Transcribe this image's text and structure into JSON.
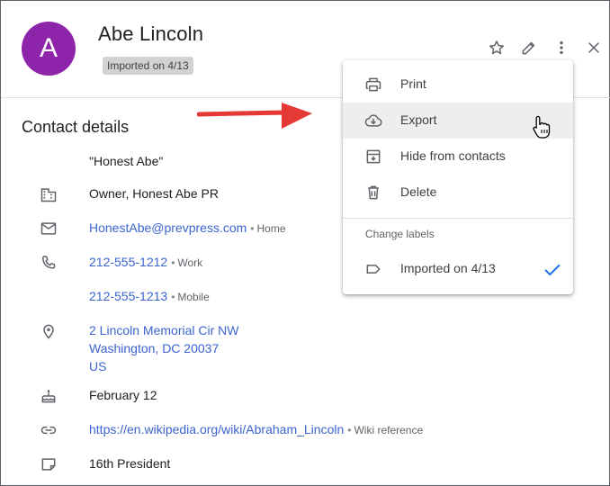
{
  "contact": {
    "avatar_initial": "A",
    "name": "Abe Lincoln",
    "label_chip": "Imported on 4/13"
  },
  "header_icons": [
    "star-icon",
    "pencil-icon",
    "more-vert-icon",
    "close-icon"
  ],
  "details": {
    "title": "Contact details",
    "nickname": "\"Honest Abe\"",
    "company": "Owner, Honest Abe PR",
    "email": "HonestAbe@prevpress.com",
    "email_type": "Home",
    "phone1": "212-555-1212",
    "phone1_type": "Work",
    "phone2": "212-555-1213",
    "phone2_type": "Mobile",
    "address_line1": "2 Lincoln Memorial Cir NW",
    "address_line2": "Washington, DC 20037",
    "address_line3": "US",
    "birthday": "February 12",
    "website": "https://en.wikipedia.org/wiki/Abraham_Lincoln",
    "website_type": "Wiki reference",
    "note": "16th President"
  },
  "menu": {
    "items": [
      {
        "label": "Print",
        "icon": "print-icon"
      },
      {
        "label": "Export",
        "icon": "cloud-download-icon"
      },
      {
        "label": "Hide from contacts",
        "icon": "archive-icon"
      },
      {
        "label": "Delete",
        "icon": "trash-icon"
      }
    ],
    "section_label": "Change labels",
    "label_option": "Imported on 4/13",
    "label_checked": true
  },
  "colors": {
    "avatar": "#8e24aa",
    "link": "#3c64d0",
    "arrow": "#e53935",
    "check": "#1a73e8",
    "hover": "#eeeeee"
  }
}
